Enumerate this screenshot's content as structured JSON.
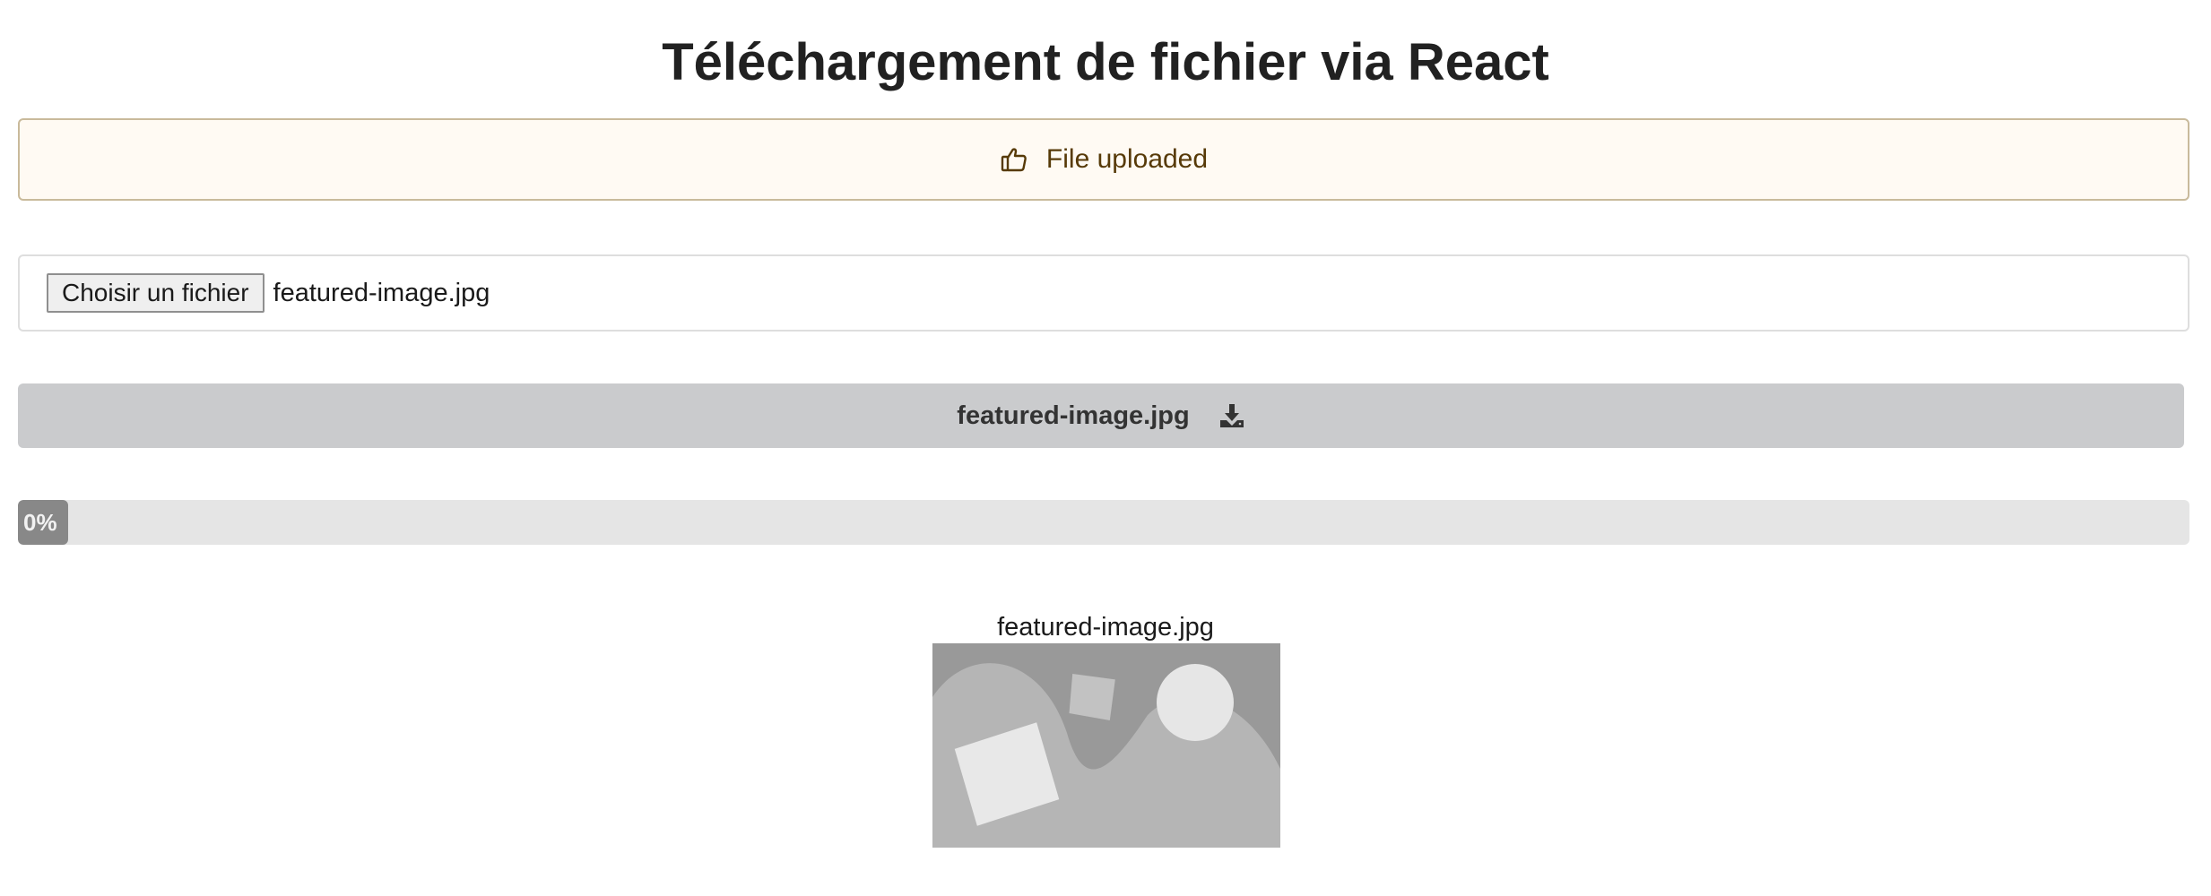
{
  "page": {
    "title": "Téléchargement de fichier via React"
  },
  "alert": {
    "icon": "thumbs-up-icon",
    "message": "File uploaded"
  },
  "file_input": {
    "button_label": "Choisir un fichier",
    "selected_file": "featured-image.jpg"
  },
  "download": {
    "label": "featured-image.jpg",
    "icon": "download-icon"
  },
  "progress": {
    "percent": 0,
    "label": "0%"
  },
  "preview": {
    "filename": "featured-image.jpg",
    "icon": "image-placeholder"
  },
  "colors": {
    "alert_bg": "#fffaf3",
    "alert_text": "#573a08",
    "button_bg": "#cacbcd",
    "progress_fill": "#888888",
    "progress_track": "#e5e5e5"
  }
}
